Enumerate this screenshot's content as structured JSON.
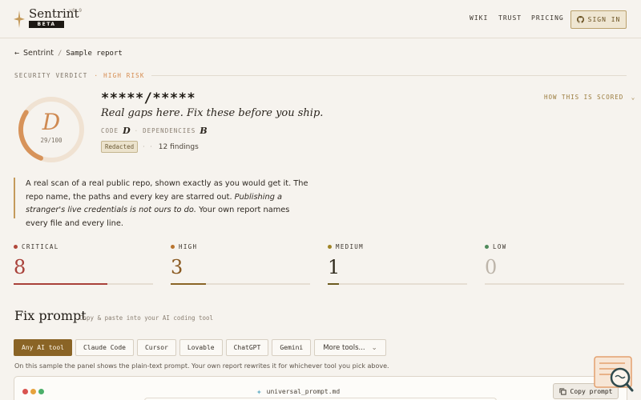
{
  "header": {
    "brand": "Sentrint",
    "version": "v0.9",
    "beta": "BETA",
    "nav": [
      "WIKI",
      "TRUST",
      "PRICING"
    ],
    "signin_label": "SIGN IN"
  },
  "breadcrumb": {
    "root": "Sentrint",
    "separator": "/",
    "current": "Sample report"
  },
  "verdict": {
    "label": "SECURITY VERDICT",
    "separator": "·",
    "risk": "HIGH RISK",
    "risk_color": "#d58a4d"
  },
  "grade": {
    "letter": "D",
    "score_text": "29/100",
    "score": 29,
    "max": 100
  },
  "report": {
    "repo": "*****/*****",
    "tagline": "Real gaps here. Fix these before you ship.",
    "code_label": "CODE",
    "code_grade": "D",
    "dependencies_label": "DEPENDENCIES",
    "dependencies_grade": "B",
    "redacted_badge": "Redacted",
    "findings": "12 findings",
    "how_scored": "HOW THIS IS SCORED"
  },
  "quote": {
    "part1": "A real scan of a real public repo, shown exactly as you would get it. The repo name, the paths and every key are starred out. ",
    "emphasis": "Publishing a stranger's live credentials is not ours to do.",
    "part2": " Your own report names every file and every line."
  },
  "severity": [
    {
      "label": "CRITICAL",
      "count": "8",
      "color": "#b0473a",
      "bar_color": "#a9413a",
      "fill": 0.67
    },
    {
      "label": "HIGH",
      "count": "3",
      "color": "#8a5a22",
      "bar_color": "#8a6426",
      "fill": 0.25
    },
    {
      "label": "MEDIUM",
      "count": "1",
      "color": "#3a3a1e",
      "bar_color": "#6b5a1e",
      "fill": 0.08
    },
    {
      "label": "LOW",
      "count": "0",
      "color": "#b9b2a8",
      "bar_color": "#4f8a5b",
      "fill": 0
    }
  ],
  "fix_prompt": {
    "title": "Fix prompt",
    "subtitle": "Copy & paste into your AI coding tool",
    "tools": [
      "Any AI tool",
      "Claude Code",
      "Cursor",
      "Lovable",
      "ChatGPT",
      "Gemini"
    ],
    "more_tools": "More tools...",
    "note": "On this sample the panel shows the plain-text prompt. Your own report rewrites it for whichever tool you pick above.",
    "file_name": "universal_prompt.md",
    "copy_label": "Copy prompt"
  }
}
